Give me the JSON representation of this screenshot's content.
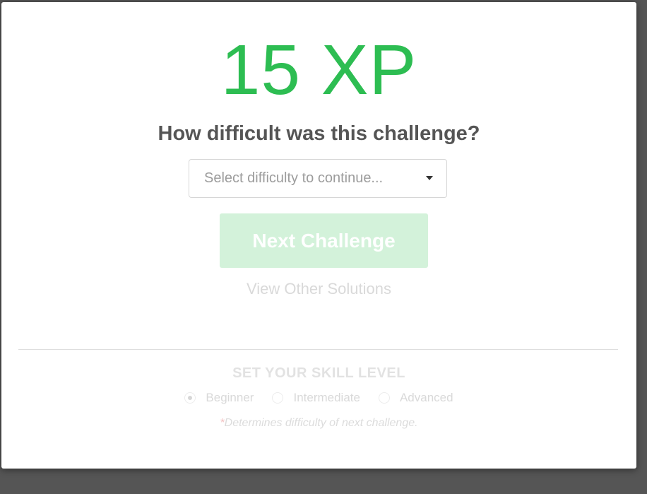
{
  "score": {
    "xp_text": "15 XP"
  },
  "question": "How difficult was this challenge?",
  "difficulty_select": {
    "placeholder": "Select difficulty to continue..."
  },
  "next_button": {
    "label": "Next Challenge"
  },
  "view_solutions": {
    "label": "View Other Solutions"
  },
  "skill_level": {
    "title": "SET YOUR SKILL LEVEL",
    "options": [
      {
        "label": "Beginner",
        "selected": true
      },
      {
        "label": "Intermediate",
        "selected": false
      },
      {
        "label": "Advanced",
        "selected": false
      }
    ],
    "note_asterisk": "*",
    "note": "Determines difficulty of next challenge."
  },
  "colors": {
    "accent": "#2dbd52",
    "button_disabled": "#d3f2da"
  },
  "icons": {
    "select_caret": "caret-down-icon"
  }
}
